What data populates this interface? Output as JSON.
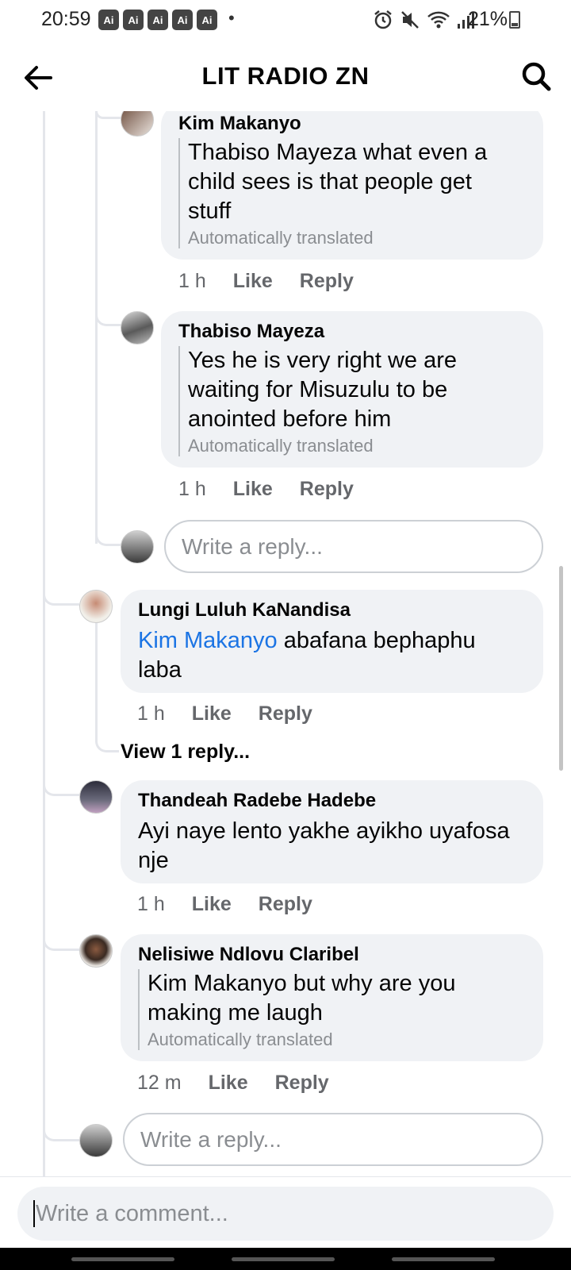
{
  "status_bar": {
    "time": "20:59",
    "ai_badges": [
      "Ai",
      "Ai",
      "Ai",
      "Ai",
      "Ai"
    ],
    "dot": "•",
    "battery": "21%",
    "icons": [
      "alarm-icon",
      "mute-icon",
      "wifi-icon",
      "signal-icon",
      "battery-icon"
    ]
  },
  "header": {
    "title": "LIT RADIO ZN",
    "back_icon": "arrow-left-icon",
    "search_icon": "search-icon"
  },
  "comments": [
    {
      "author": "Kim Makanyo",
      "text": "Thabiso Mayeza what even a child sees is that people get stuff",
      "lines": [
        "Thabiso Mayeza what even a",
        "child sees is that people get",
        "stuff"
      ],
      "translated": "Automatically translated",
      "time": "1 h",
      "like": "Like",
      "reply": "Reply"
    },
    {
      "author": "Thabiso Mayeza",
      "lines": [
        "Yes he is very right we are",
        "waiting for Misuzulu to be",
        "anointed before him"
      ],
      "translated": "Automatically translated",
      "time": "1 h",
      "like": "Like",
      "reply": "Reply"
    },
    {
      "author": "Lungi Luluh KaNandisa",
      "mention": "Kim Makanyo",
      "line1_rest": " abafana bephaphu",
      "line2": "laba",
      "time": "1 h",
      "like": "Like",
      "reply": "Reply",
      "view_replies": "View 1 reply..."
    },
    {
      "author": "Thandeah Radebe Hadebe",
      "lines": [
        "Ayi naye lento yakhe ayikho uyafosa",
        "nje"
      ],
      "time": "1 h",
      "like": "Like",
      "reply": "Reply"
    },
    {
      "author": "Nelisiwe Ndlovu Claribel",
      "lines": [
        "Kim Makanyo but why are you",
        "making me laugh"
      ],
      "translated": "Automatically translated",
      "time": "12 m",
      "like": "Like",
      "reply": "Reply"
    }
  ],
  "reply_placeholder": "Write a reply...",
  "comment_placeholder": "Write a comment..."
}
